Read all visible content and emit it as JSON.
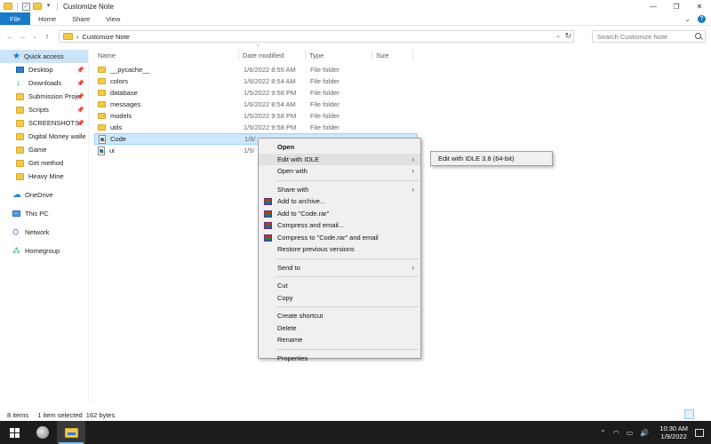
{
  "window": {
    "title": "Customize Note",
    "controls": {
      "minimize": "—",
      "maximize": "❐",
      "close": "✕"
    }
  },
  "ribbon": {
    "tabs": [
      {
        "label": "File",
        "active": true
      },
      {
        "label": "Home"
      },
      {
        "label": "Share"
      },
      {
        "label": "View"
      }
    ],
    "collapse_glyph": "⌄",
    "help_glyph": "?"
  },
  "address_bar": {
    "separator": "›",
    "path": "Customize Note",
    "search_placeholder": "Search Customize Note"
  },
  "sidebar": {
    "quick_access": {
      "label": "Quick access",
      "icon": "star-icon"
    },
    "pinned": [
      {
        "label": "Desktop",
        "icon": "desktop-icon",
        "pinned": true
      },
      {
        "label": "Downloads",
        "icon": "download-icon",
        "pinned": true
      },
      {
        "label": "Submission Proje",
        "icon": "folder-icon",
        "pinned": true
      },
      {
        "label": "Scripts",
        "icon": "folder-icon",
        "pinned": true
      },
      {
        "label": "SCREENSHOTS",
        "icon": "folder-icon",
        "pinned": true
      },
      {
        "label": "Digital Money walle",
        "icon": "folder-icon",
        "pinned": false
      },
      {
        "label": "Game",
        "icon": "folder-icon",
        "pinned": false
      },
      {
        "label": "Get method",
        "icon": "folder-icon",
        "pinned": false
      },
      {
        "label": "Heavy Mine",
        "icon": "folder-icon",
        "pinned": false
      }
    ],
    "other": [
      {
        "label": "OneDrive",
        "icon": "cloud-icon"
      },
      {
        "label": "This PC",
        "icon": "computer-icon"
      },
      {
        "label": "Network",
        "icon": "network-icon"
      },
      {
        "label": "Homegroup",
        "icon": "homegroup-icon"
      }
    ]
  },
  "file_list": {
    "columns": {
      "name": "Name",
      "date": "Date modified",
      "type": "Type",
      "size": "Size"
    },
    "rows": [
      {
        "name": "__pycache__",
        "date": "1/6/2022 8:55 AM",
        "type": "File folder",
        "kind": "folder"
      },
      {
        "name": "colors",
        "date": "1/6/2022 8:54 AM",
        "type": "File folder",
        "kind": "folder"
      },
      {
        "name": "database",
        "date": "1/5/2022 9:58 PM",
        "type": "File folder",
        "kind": "folder"
      },
      {
        "name": "messages",
        "date": "1/6/2022 8:54 AM",
        "type": "File folder",
        "kind": "folder"
      },
      {
        "name": "models",
        "date": "1/5/2022 9:58 PM",
        "type": "File folder",
        "kind": "folder"
      },
      {
        "name": "utils",
        "date": "1/5/2022 9:58 PM",
        "type": "File folder",
        "kind": "folder"
      },
      {
        "name": "Code",
        "date": "1/6/",
        "type": "",
        "kind": "python",
        "selected": true
      },
      {
        "name": "ui",
        "date": "1/5/",
        "type": "",
        "kind": "python"
      }
    ]
  },
  "context_menu": {
    "items": [
      {
        "label": "Open",
        "bold": true
      },
      {
        "label": "Edit with IDLE",
        "submenu": true,
        "hover": true
      },
      {
        "label": "Open with",
        "submenu": true
      },
      {
        "sep": true
      },
      {
        "label": "Share with",
        "submenu": true
      },
      {
        "label": "Add to archive...",
        "icon": "winrar-icon"
      },
      {
        "label": "Add to \"Code.rar\"",
        "icon": "winrar-icon"
      },
      {
        "label": "Compress and email...",
        "icon": "winrar-icon"
      },
      {
        "label": "Compress to \"Code.rar\" and email",
        "icon": "winrar-icon"
      },
      {
        "label": "Restore previous versions"
      },
      {
        "sep": true
      },
      {
        "label": "Send to",
        "submenu": true
      },
      {
        "sep": true
      },
      {
        "label": "Cut"
      },
      {
        "label": "Copy"
      },
      {
        "sep": true
      },
      {
        "label": "Create shortcut"
      },
      {
        "label": "Delete"
      },
      {
        "label": "Rename"
      },
      {
        "sep": true
      },
      {
        "label": "Properties"
      }
    ],
    "submenu_item": "Edit with IDLE 3.8 (64-bit)"
  },
  "status_bar": {
    "item_count": "8 items",
    "selection": "1 item selected  162 bytes"
  },
  "taskbar": {
    "time": "10:30 AM",
    "date": "1/9/2022"
  }
}
